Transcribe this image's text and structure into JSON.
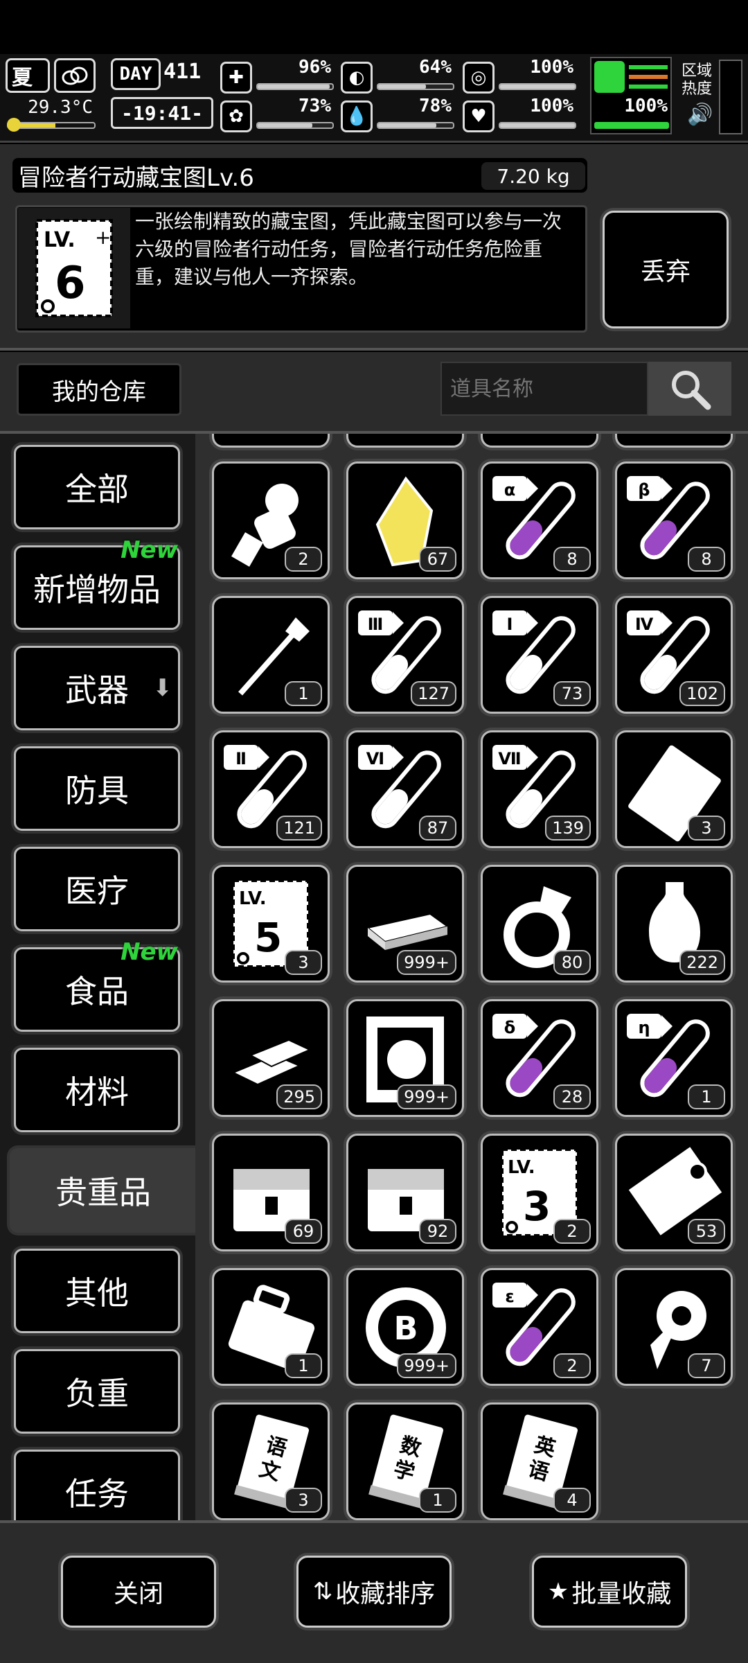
{
  "hud": {
    "season": "夏",
    "temperature": "29.3°C",
    "day_label": "DAY",
    "day_number": "411",
    "time": "-19:41-",
    "stats": [
      {
        "icon": "medkit-icon",
        "value": "96%",
        "level": 0.96
      },
      {
        "icon": "stomach-icon",
        "value": "64%",
        "level": 0.64
      },
      {
        "icon": "bladder-icon",
        "value": "100%",
        "level": 1.0
      },
      {
        "icon": "brain-icon",
        "value": "73%",
        "level": 0.73
      },
      {
        "icon": "water-drop-icon",
        "value": "78%",
        "level": 0.78
      },
      {
        "icon": "heart-icon",
        "value": "100%",
        "level": 1.0
      }
    ],
    "stamina": "100%",
    "area_heat": "区域\n热度"
  },
  "item": {
    "name": "冒险者行动藏宝图Lv.6",
    "weight": "7.20 kg",
    "level_badge": "6",
    "lv_text": "LV.",
    "description": "一张绘制精致的藏宝图，凭此藏宝图可以参与一次六级的冒险者行动任务，冒险者行动任务危险重重，建议与他人一齐探索。",
    "discard_label": "丢弃"
  },
  "warehouse": {
    "title": "我的仓库",
    "search_placeholder": "道具名称"
  },
  "categories": [
    {
      "label": "全部",
      "new": ""
    },
    {
      "label": "新增物品",
      "new": "New"
    },
    {
      "label": "武器",
      "new": ""
    },
    {
      "label": "防具",
      "new": ""
    },
    {
      "label": "医疗",
      "new": ""
    },
    {
      "label": "食品",
      "new": "New"
    },
    {
      "label": "材料",
      "new": ""
    },
    {
      "label": "贵重品",
      "new": ""
    },
    {
      "label": "其他",
      "new": ""
    },
    {
      "label": "负重",
      "new": ""
    },
    {
      "label": "任务",
      "new": ""
    }
  ],
  "items": [
    {
      "icon": "astronaut-icon",
      "count": "2"
    },
    {
      "icon": "yellow-crystal-icon",
      "count": "67"
    },
    {
      "icon": "alpha-potion-icon",
      "count": "8",
      "tag": "α"
    },
    {
      "icon": "beta-potion-icon",
      "count": "8",
      "tag": "β"
    },
    {
      "icon": "scepter-icon",
      "count": "1"
    },
    {
      "icon": "potion-iii-icon",
      "count": "127",
      "tag": "Ⅲ"
    },
    {
      "icon": "potion-i-icon",
      "count": "73",
      "tag": "Ⅰ"
    },
    {
      "icon": "potion-iv-icon",
      "count": "102",
      "tag": "Ⅳ"
    },
    {
      "icon": "potion-ii-icon",
      "count": "121",
      "tag": "Ⅱ"
    },
    {
      "icon": "potion-vi-icon",
      "count": "87",
      "tag": "Ⅵ"
    },
    {
      "icon": "potion-vii-icon",
      "count": "139",
      "tag": "Ⅶ"
    },
    {
      "icon": "ticket-icon",
      "count": "3"
    },
    {
      "icon": "treasure-map-lv5-icon",
      "count": "3",
      "tag": "5"
    },
    {
      "icon": "cash-stack-icon",
      "count": "999+"
    },
    {
      "icon": "diamond-ring-icon",
      "count": "80"
    },
    {
      "icon": "vase-icon",
      "count": "222"
    },
    {
      "icon": "gold-bars-icon",
      "count": "295"
    },
    {
      "icon": "poster-icon",
      "count": "999+"
    },
    {
      "icon": "delta-potion-icon",
      "count": "28",
      "tag": "δ"
    },
    {
      "icon": "eta-potion-icon",
      "count": "1",
      "tag": "η"
    },
    {
      "icon": "chest-ii-icon",
      "count": "69"
    },
    {
      "icon": "chest-i-icon",
      "count": "92"
    },
    {
      "icon": "treasure-map-lv3-icon",
      "count": "2",
      "tag": "3"
    },
    {
      "icon": "dna-certificate-icon",
      "count": "53"
    },
    {
      "icon": "briefcase-icon",
      "count": "1"
    },
    {
      "icon": "bitcoin-coin-icon",
      "count": "999+"
    },
    {
      "icon": "epsilon-potion-icon",
      "count": "2",
      "tag": "ε"
    },
    {
      "icon": "flower-medal-icon",
      "count": "7"
    },
    {
      "icon": "chinese-book-icon",
      "count": "3",
      "tag": "语文"
    },
    {
      "icon": "math-book-icon",
      "count": "1",
      "tag": "数学"
    },
    {
      "icon": "english-book-icon",
      "count": "4",
      "tag": "英语"
    }
  ],
  "bottom": {
    "close": "关闭",
    "sort": "收藏排序",
    "batch": "批量收藏"
  }
}
